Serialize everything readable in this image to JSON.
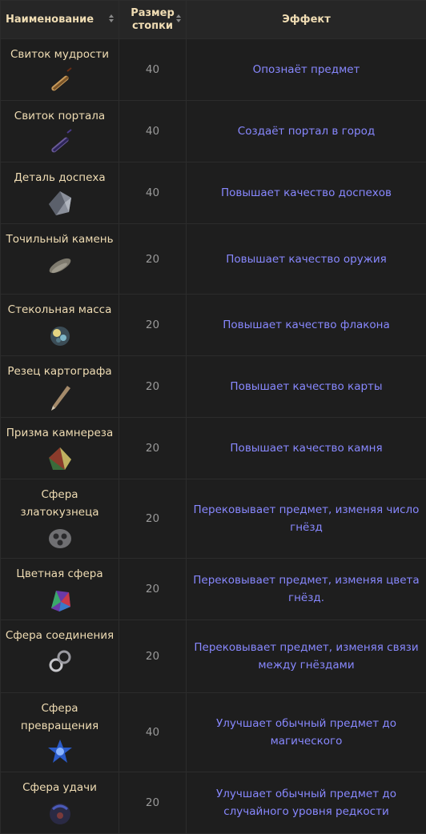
{
  "headers": {
    "name": "Наименование",
    "stack": "Размер стопки",
    "effect": "Эффект"
  },
  "rows": [
    {
      "name": "Свиток мудрости",
      "stack": "40",
      "effect": "Опознаёт предмет",
      "icon": "scroll-of-wisdom-icon"
    },
    {
      "name": "Свиток портала",
      "stack": "40",
      "effect": "Создаёт портал в город",
      "icon": "portal-scroll-icon"
    },
    {
      "name": "Деталь доспеха",
      "stack": "40",
      "effect": "Повышает качество доспехов",
      "icon": "armourer-scrap-icon"
    },
    {
      "name": "Точильный камень",
      "stack": "20",
      "effect": "Повышает качество оружия",
      "icon": "whetstone-icon"
    },
    {
      "name": "Стекольная масса",
      "stack": "20",
      "effect": "Повышает качество флакона",
      "icon": "glassblower-bauble-icon"
    },
    {
      "name": "Резец картографа",
      "stack": "20",
      "effect": "Повышает качество карты",
      "icon": "cartographer-chisel-icon"
    },
    {
      "name": "Призма камнереза",
      "stack": "20",
      "effect": "Повышает качество камня",
      "icon": "gemcutter-prism-icon"
    },
    {
      "name": "Сфера златокузнеца",
      "stack": "20",
      "effect": "Перековывает предмет, изменяя число гнёзд",
      "icon": "jeweller-orb-icon"
    },
    {
      "name": "Цветная сфера",
      "stack": "20",
      "effect": "Перековывает предмет, изменяя цвета гнёзд.",
      "icon": "chromatic-orb-icon"
    },
    {
      "name": "Сфера соединения",
      "stack": "20",
      "effect": "Перековывает предмет, изменяя связи между гнёздами",
      "icon": "orb-of-fusing-icon"
    },
    {
      "name": "Сфера превращения",
      "stack": "40",
      "effect": "Улучшает обычный предмет до магического",
      "icon": "orb-of-transmutation-icon"
    },
    {
      "name": "Сфера удачи",
      "stack": "20",
      "effect": "Улучшает обычный предмет до случайного уровня редкости",
      "icon": "orb-of-chance-icon"
    }
  ],
  "colors": {
    "name": "#f0ddb4",
    "stack": "#9a9a9a",
    "effect": "#8888ff",
    "background": "#1e1e1e",
    "header_bg": "#262626"
  }
}
